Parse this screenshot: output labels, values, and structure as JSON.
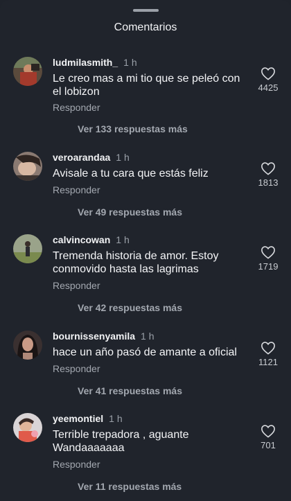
{
  "header": {
    "title": "Comentarios"
  },
  "reply_label": "Responder",
  "comments": [
    {
      "username": "ludmilasmith_",
      "time": "1 h",
      "text": "Le creo mas a mi tio que se peleó con el lobizon",
      "likes": "4425",
      "more_replies": "Ver 133 respuestas más"
    },
    {
      "username": "veroarandaa",
      "time": "1 h",
      "text": "Avisale a tu cara que estás feliz",
      "likes": "1813",
      "more_replies": "Ver 49 respuestas más"
    },
    {
      "username": "calvincowan",
      "time": "1 h",
      "text": "Tremenda historia de amor. Estoy conmovido hasta las lagrimas",
      "likes": "1719",
      "more_replies": "Ver 42 respuestas más"
    },
    {
      "username": "bournissenyamila",
      "time": "1 h",
      "text": "hace un año pasó de amante a oficial",
      "likes": "1121",
      "more_replies": "Ver 41 respuestas más"
    },
    {
      "username": "yeemontiel",
      "time": "1 h",
      "text": "Terrible trepadora , aguante Wandaaaaaaa",
      "likes": "701",
      "more_replies": "Ver 11 respuestas más"
    }
  ]
}
